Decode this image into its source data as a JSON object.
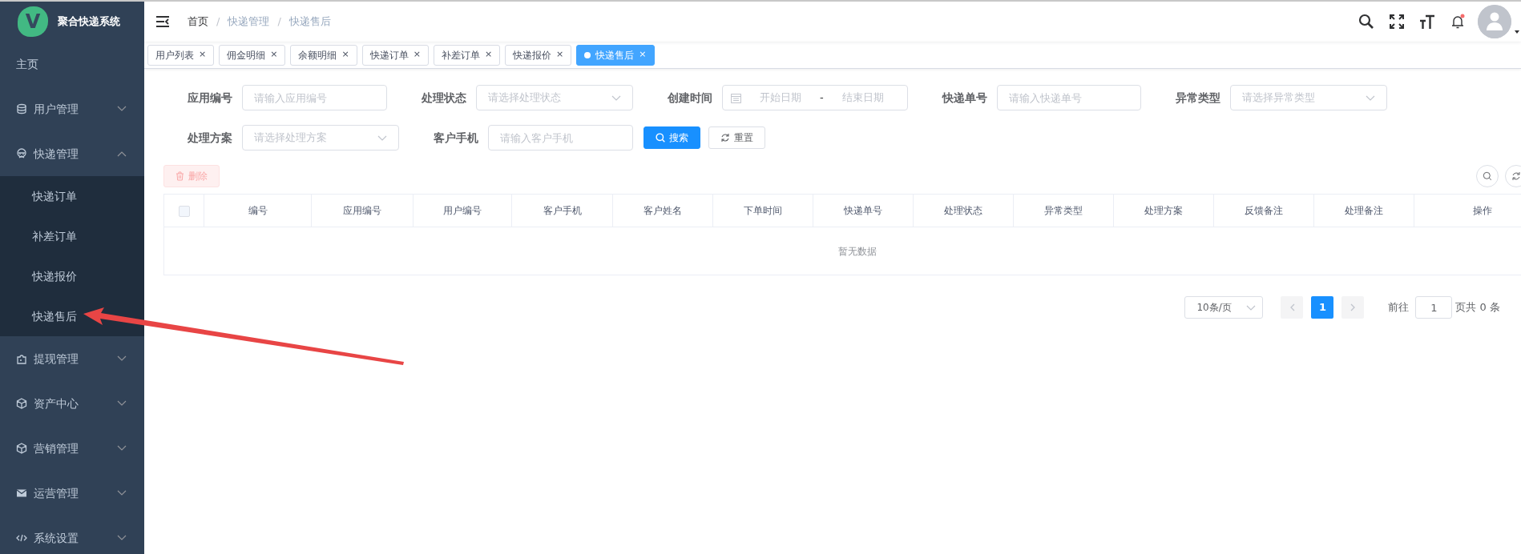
{
  "sidebar": {
    "title": "聚合快递系统",
    "logo_letter": "V",
    "items": [
      {
        "label": "主页"
      },
      {
        "label": "用户管理",
        "expanded": false
      },
      {
        "label": "快递管理",
        "expanded": true,
        "children": [
          {
            "label": "快递订单"
          },
          {
            "label": "补差订单"
          },
          {
            "label": "快递报价"
          },
          {
            "label": "快递售后"
          }
        ]
      },
      {
        "label": "提现管理",
        "expanded": false
      },
      {
        "label": "资产中心",
        "expanded": false
      },
      {
        "label": "营销管理",
        "expanded": false
      },
      {
        "label": "运营管理",
        "expanded": false
      },
      {
        "label": "系统设置",
        "expanded": false
      }
    ]
  },
  "breadcrumb": [
    {
      "label": "首页",
      "link": true
    },
    {
      "label": "快递管理",
      "link": false
    },
    {
      "label": "快递售后",
      "link": false
    }
  ],
  "breadcrumb_separator": "/",
  "notification_dot": true,
  "tabs": [
    {
      "label": "用户列表",
      "selected": false
    },
    {
      "label": "佣金明细",
      "selected": false
    },
    {
      "label": "余额明细",
      "selected": false
    },
    {
      "label": "快递订单",
      "selected": false
    },
    {
      "label": "补差订单",
      "selected": false
    },
    {
      "label": "快递报价",
      "selected": false
    },
    {
      "label": "快递售后",
      "selected": true
    }
  ],
  "tab_close": "×",
  "filters": [
    {
      "kind": "input",
      "label": "应用编号",
      "placeholder": "请输入应用编号"
    },
    {
      "kind": "select",
      "label": "处理状态",
      "placeholder": "请选择处理状态"
    },
    {
      "kind": "daterange",
      "label": "创建时间",
      "start_placeholder": "开始日期",
      "separator": "-",
      "end_placeholder": "结束日期"
    },
    {
      "kind": "input",
      "label": "快递单号",
      "placeholder": "请输入快递单号"
    },
    {
      "kind": "select",
      "label": "异常类型",
      "placeholder": "请选择异常类型"
    },
    {
      "kind": "select",
      "label": "处理方案",
      "placeholder": "请选择处理方案"
    },
    {
      "kind": "input",
      "label": "客户手机",
      "placeholder": "请输入客户手机"
    }
  ],
  "search_button": "搜索",
  "reset_button": "重置",
  "delete_button": {
    "label": "删除",
    "disabled": true
  },
  "table": {
    "select_all_checked": false,
    "columns": [
      "编号",
      "应用编号",
      "用户编号",
      "客户手机",
      "客户姓名",
      "下单时间",
      "快递单号",
      "处理状态",
      "异常类型",
      "处理方案",
      "反馈备注",
      "处理备注",
      "操作"
    ],
    "empty_text": "暂无数据"
  },
  "pagination": {
    "page_size": "10条/页",
    "prev_disabled": true,
    "next_disabled": true,
    "pages": [
      {
        "label": "1",
        "selected": true
      }
    ],
    "goto_label": "前往",
    "goto_value": "1",
    "goto_suffix": "页",
    "total": "共 0 条"
  }
}
